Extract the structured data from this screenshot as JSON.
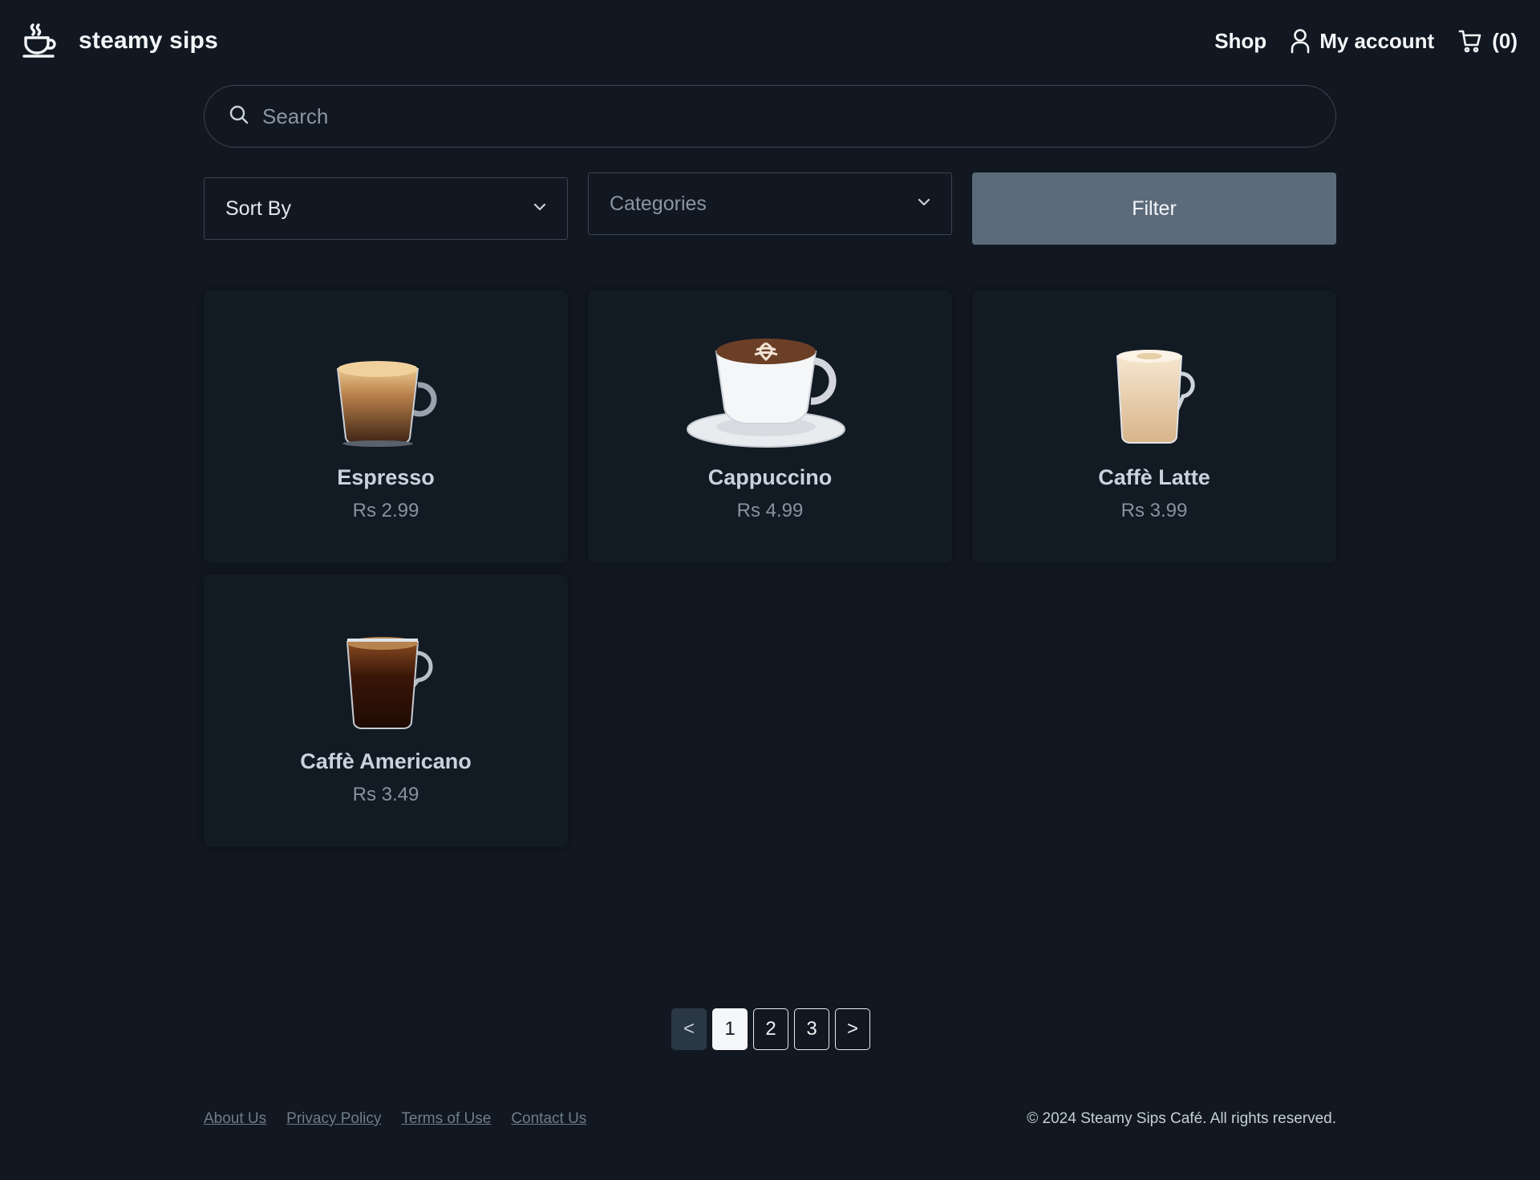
{
  "brand": {
    "name": "steamy sips",
    "logo_icon": "coffee-cup-icon"
  },
  "nav": {
    "shop": "Shop",
    "account": "My account",
    "cart": "(0)"
  },
  "search": {
    "placeholder": "Search"
  },
  "filters": {
    "sort_label": "Sort By",
    "categories_placeholder": "Categories",
    "filter_button": "Filter"
  },
  "products": [
    {
      "name": "Espresso",
      "price": "Rs 2.99"
    },
    {
      "name": "Cappuccino",
      "price": "Rs 4.99"
    },
    {
      "name": "Caffè Latte",
      "price": "Rs 3.99"
    },
    {
      "name": "Caffè Americano",
      "price": "Rs 3.49"
    }
  ],
  "pagination": {
    "prev": "<",
    "pages": [
      "1",
      "2",
      "3"
    ],
    "next": ">",
    "current": "1"
  },
  "footer": {
    "links": [
      "About Us",
      "Privacy Policy",
      "Terms of Use",
      "Contact Us"
    ],
    "copyright": "© 2024 Steamy Sips Café. All rights reserved."
  },
  "colors": {
    "background": "#111821",
    "filter_button": "#5b6b7a",
    "active_page": "#f4f6f8"
  }
}
